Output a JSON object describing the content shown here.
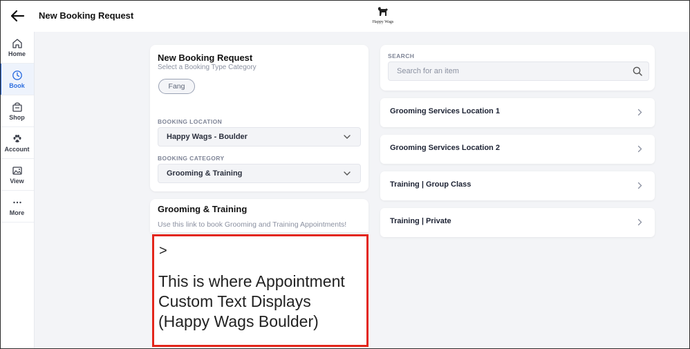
{
  "header": {
    "title": "New Booking Request",
    "logo_text": "Happy Wags"
  },
  "sidebar": {
    "items": [
      {
        "label": "Home",
        "icon": "home-icon"
      },
      {
        "label": "Book",
        "icon": "clock-icon",
        "active": true
      },
      {
        "label": "Shop",
        "icon": "shop-icon"
      },
      {
        "label": "Account",
        "icon": "paw-icon"
      },
      {
        "label": "View",
        "icon": "image-icon"
      },
      {
        "label": "More",
        "icon": "dots-icon"
      }
    ]
  },
  "booking": {
    "title": "New Booking Request",
    "subtitle": "Select a Booking Type Category",
    "pet_chip": "Fang",
    "location_label": "BOOKING LOCATION",
    "location_value": "Happy Wags - Boulder",
    "category_label": "BOOKING CATEGORY",
    "category_value": "Grooming & Training"
  },
  "info": {
    "title": "Grooming & Training",
    "text": "Use this link to book Grooming and Training Appointments!",
    "arrow": ">",
    "custom_text": "This is where Appointment Custom Text Displays (Happy Wags Boulder)"
  },
  "search": {
    "label": "SEARCH",
    "placeholder": "Search for an item"
  },
  "services": [
    {
      "label": "Grooming Services Location 1"
    },
    {
      "label": "Grooming Services Location 2"
    },
    {
      "label": "Training | Group Class"
    },
    {
      "label": "Training | Private"
    }
  ],
  "colors": {
    "accent": "#2f6fe0",
    "highlight_border": "#e3261b",
    "background": "#f3f4f7"
  }
}
